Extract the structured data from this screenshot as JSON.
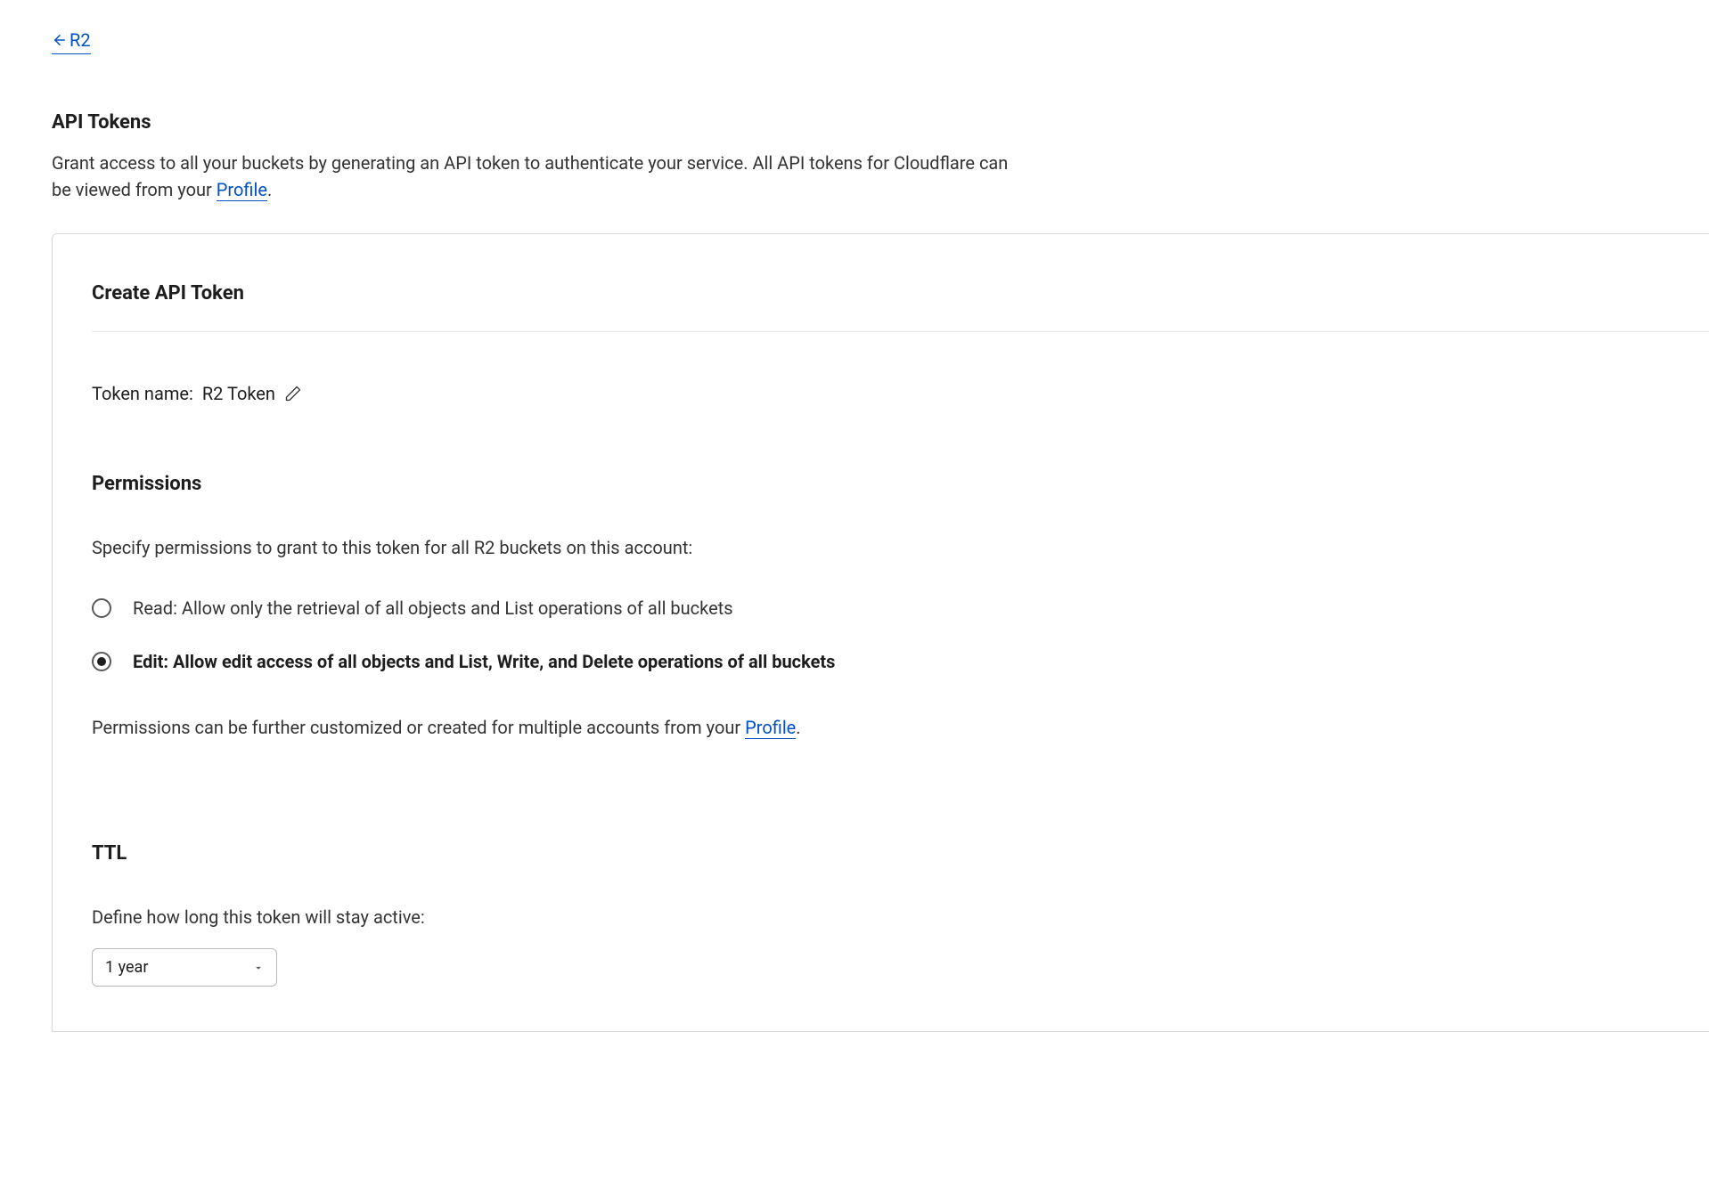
{
  "breadcrumb": {
    "back_label": "R2"
  },
  "header": {
    "title": "API Tokens",
    "description_before": "Grant access to all your buckets by generating an API token to authenticate your service. All API tokens for Cloudflare can be viewed from your ",
    "description_link": "Profile",
    "description_after": "."
  },
  "card": {
    "title": "Create API Token",
    "token_name_label": "Token name:",
    "token_name_value": "R2 Token"
  },
  "permissions": {
    "title": "Permissions",
    "description": "Specify permissions to grant to this token for all R2 buckets on this account:",
    "options": [
      "Read: Allow only the retrieval of all objects and List operations of all buckets",
      "Edit: Allow edit access of all objects and List, Write, and Delete operations of all buckets"
    ],
    "selected_index": 1,
    "note_before": "Permissions can be further customized or created for multiple accounts from your ",
    "note_link": "Profile",
    "note_after": "."
  },
  "ttl": {
    "title": "TTL",
    "description": "Define how long this token will stay active:",
    "selected": "1 year"
  }
}
